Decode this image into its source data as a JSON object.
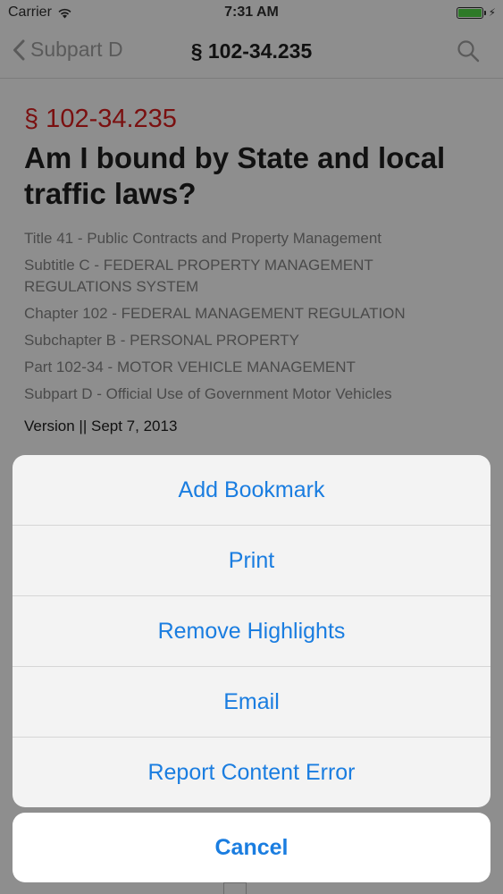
{
  "status_bar": {
    "carrier": "Carrier",
    "time": "7:31 AM",
    "battery_level": 1.0,
    "battery_color": "#2e7a28",
    "icons": [
      "wifi-icon",
      "battery-icon",
      "charging-bolt-icon"
    ]
  },
  "nav": {
    "back_label": "Subpart D",
    "title": "§ 102-34.235",
    "icons": [
      "chevron-left-icon",
      "search-icon"
    ]
  },
  "content": {
    "section_number": "§ 102-34.235",
    "section_title": "Am I bound by State and local traffic laws?",
    "hierarchy": [
      "Title 41 - Public Contracts and Property Management",
      "Subtitle C - FEDERAL PROPERTY MANAGEMENT REGULATIONS SYSTEM",
      "Chapter 102 - FEDERAL MANAGEMENT REGULATION",
      "Subchapter B - PERSONAL PROPERTY",
      "Part 102-34 - MOTOR VEHICLE MANAGEMENT",
      "Subpart D - Official Use of Government Motor Vehicles"
    ],
    "version": "Version || Sept 7, 2013"
  },
  "action_sheet": {
    "items": [
      {
        "label": "Add Bookmark"
      },
      {
        "label": "Print"
      },
      {
        "label": "Remove Highlights"
      },
      {
        "label": "Email"
      },
      {
        "label": "Report Content Error"
      }
    ],
    "cancel_label": "Cancel",
    "accent_color": "#1a7de0"
  }
}
